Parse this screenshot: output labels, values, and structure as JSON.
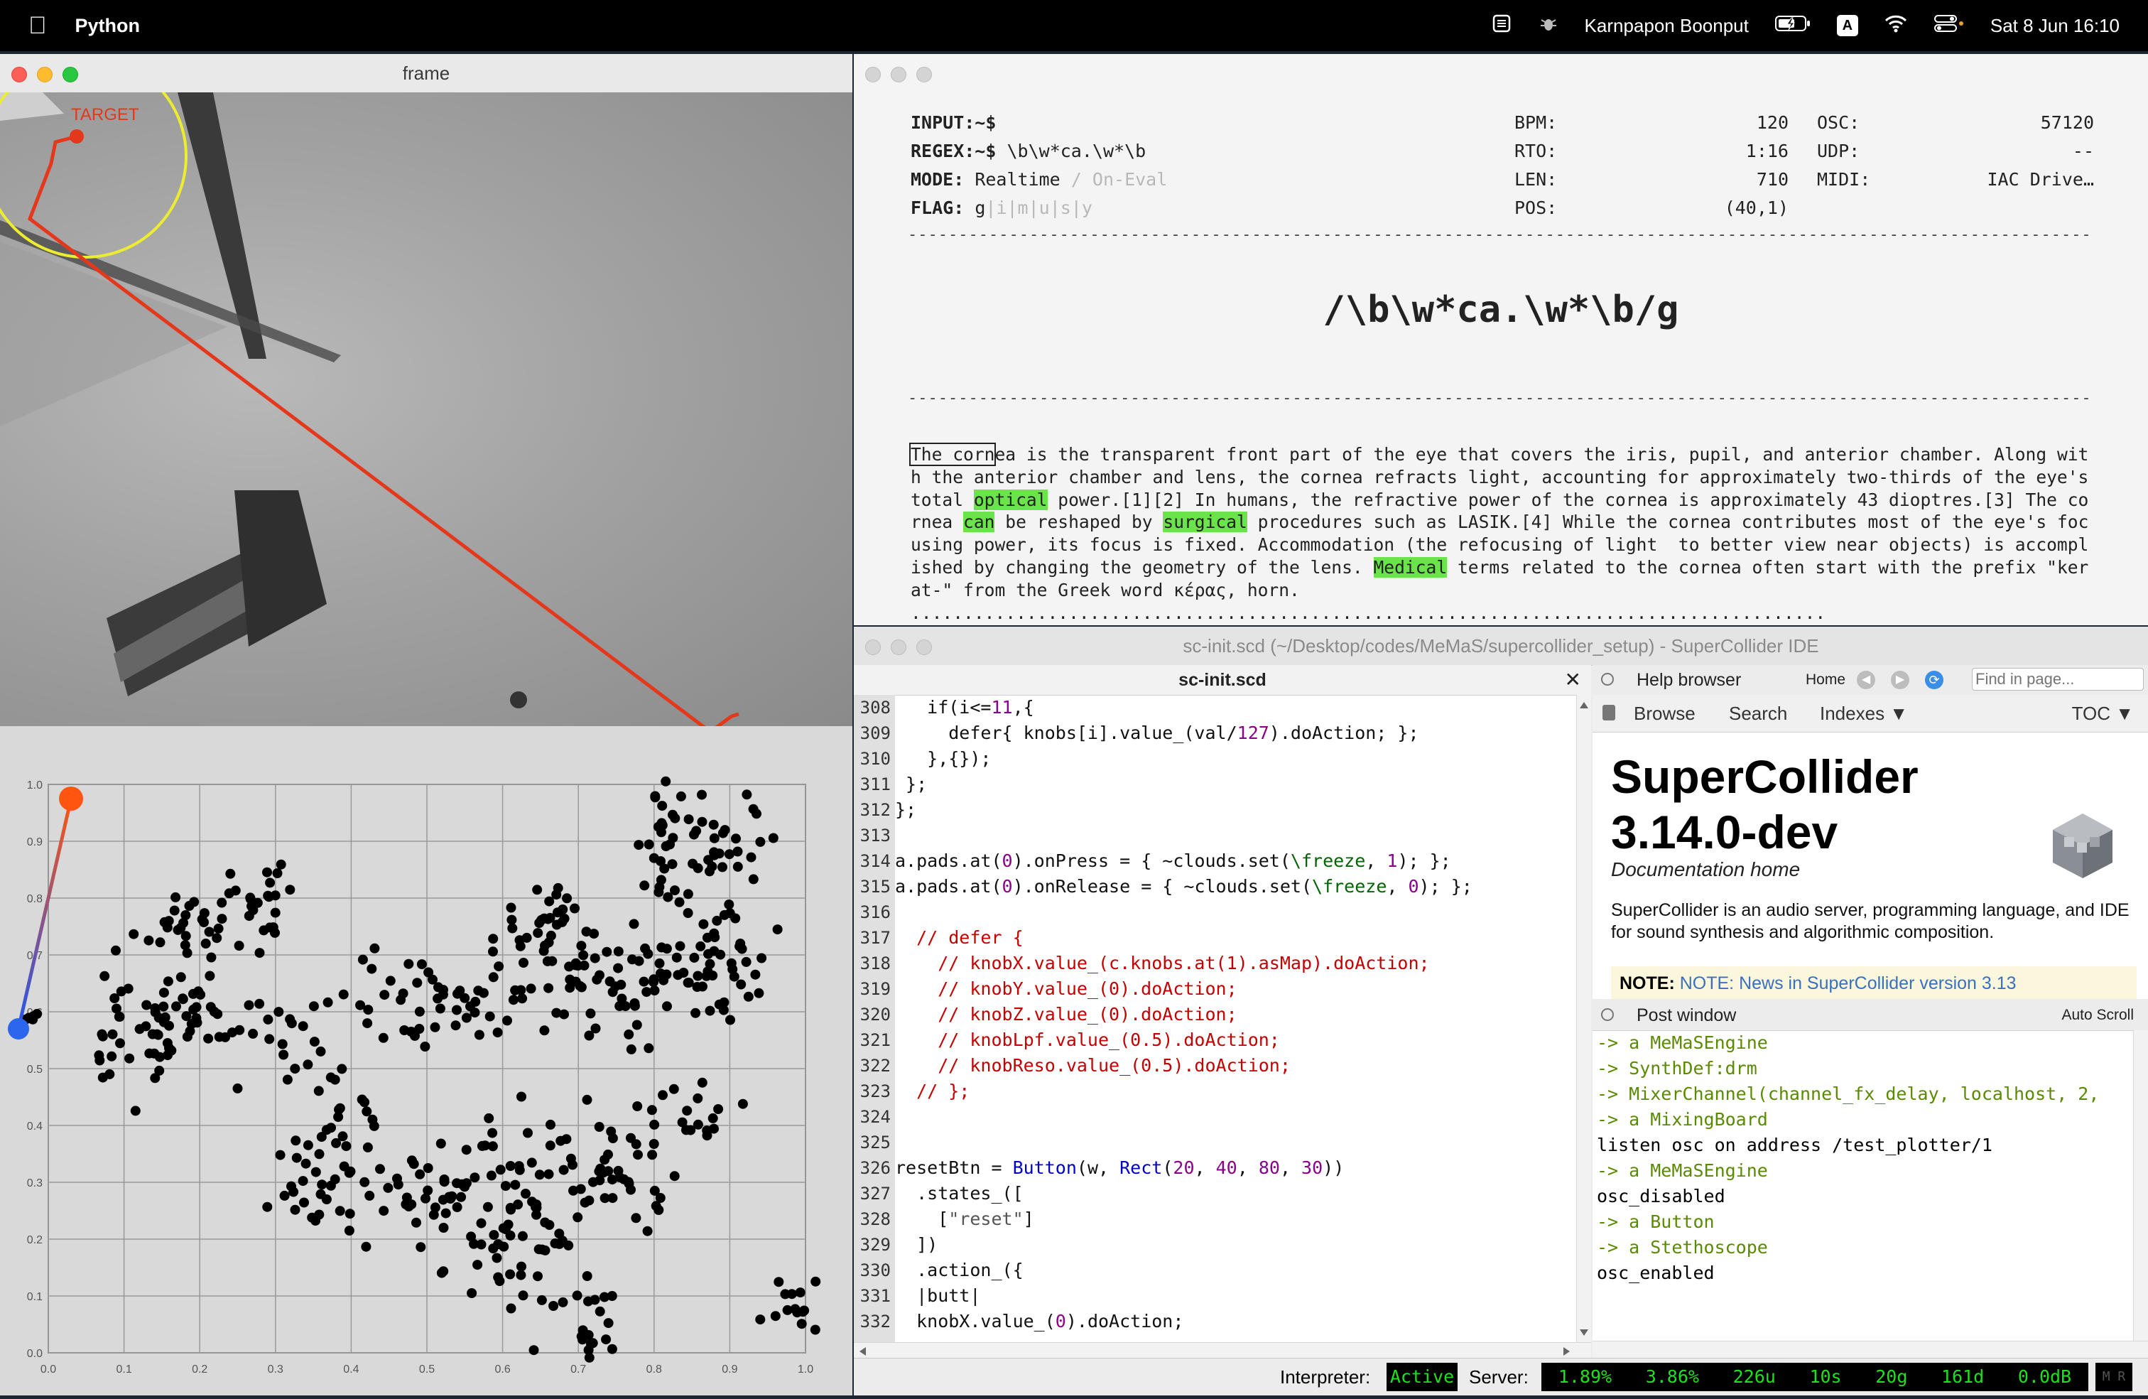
{
  "menubar": {
    "app_name": "Python",
    "user": "Karnpapon Boonput",
    "datetime": "Sat 8 Jun  16:10",
    "input_badge": "A"
  },
  "frame_window": {
    "title": "frame",
    "target_label": "TARGET"
  },
  "plotter": {
    "y_ticks": [
      "1.0",
      "0.9",
      "0.8",
      "0.7",
      "0.6",
      "0.5",
      "0.4",
      "0.3",
      "0.2",
      "0.1",
      "0.0"
    ],
    "x_ticks": [
      "0.0",
      "0.1",
      "0.2",
      "0.3",
      "0.4",
      "0.5",
      "0.6",
      "0.7",
      "0.8",
      "0.9",
      "1.0"
    ]
  },
  "regex_window": {
    "input_label": "INPUT:~$",
    "regex_label": "REGEX:~$",
    "regex_value": "\\b\\w*ca.\\w*\\b",
    "mode_label": "MODE:",
    "mode_value": "Realtime",
    "mode_alt": "/ On-Eval",
    "flag_label": "FLAG:",
    "flag_active": "g",
    "flag_rest": "|i|m|u|s|y",
    "bpm_label": "BPM:",
    "bpm_value": "120",
    "rto_label": "RTO:",
    "rto_value": "1:16",
    "len_label": "LEN:",
    "len_value": "710",
    "pos_label": "POS:",
    "pos_value": "(40,1)",
    "osc_label": "OSC:",
    "osc_value": "57120",
    "udp_label": "UDP:",
    "udp_value": "--",
    "midi_label": "MIDI:",
    "midi_value": "IAC Drive…",
    "big_regex": "/\\b\\w*ca.\\w*\\b/g",
    "text_segments": [
      {
        "t": "The corn",
        "cls": "cursor-box"
      },
      {
        "t": "ea is the transparent front part of the eye that covers the iris, pupil, and anterior chamber. Along with the anterior chamber and lens, the cornea refracts light, accounting for approximately two-thirds of the eye's total ",
        "cls": ""
      },
      {
        "t": "optical",
        "cls": "hl"
      },
      {
        "t": " power.[1][2] In humans, the refractive power of the cornea is approximately 43 dioptres.[3] The cornea ",
        "cls": ""
      },
      {
        "t": "can",
        "cls": "hl"
      },
      {
        "t": " be reshaped by ",
        "cls": ""
      },
      {
        "t": "surgical",
        "cls": "hl"
      },
      {
        "t": " procedures such as LASIK.[4] While the cornea contributes most of the eye's focusing power, its focus is fixed. Accommodation (the refocusing of light  to better view near objects) is accomplished by changing the geometry of the lens. ",
        "cls": ""
      },
      {
        "t": "Medical",
        "cls": "hl"
      },
      {
        "t": " terms related to the cornea often start with the prefix \"kerat-\" from the Greek word κέρας, horn. .......................................................................................",
        "cls": ""
      }
    ]
  },
  "supercollider": {
    "title": "sc-init.scd (~/Desktop/codes/MeMaS/supercollider_setup) - SuperCollider IDE",
    "tab_name": "sc-init.scd",
    "code_lines": [
      {
        "n": "308",
        "html": "   if(i<=<span class=\"c-num\">11</span>,{"
      },
      {
        "n": "309",
        "html": "     defer{ knobs[i].value_(val/<span class=\"c-num\">127</span>).doAction; };"
      },
      {
        "n": "310",
        "html": "   },{});"
      },
      {
        "n": "311",
        "html": " };"
      },
      {
        "n": "312",
        "html": "};"
      },
      {
        "n": "313",
        "html": ""
      },
      {
        "n": "314",
        "html": "a.pads.at(<span class=\"c-num\">0</span>).onPress = { ~clouds.set(<span class=\"c-sym\">\\freeze</span>, <span class=\"c-num\">1</span>); };"
      },
      {
        "n": "315",
        "html": "a.pads.at(<span class=\"c-num\">0</span>).onRelease = { ~clouds.set(<span class=\"c-sym\">\\freeze</span>, <span class=\"c-num\">0</span>); };"
      },
      {
        "n": "316",
        "html": ""
      },
      {
        "n": "317",
        "html": "<span class=\"c-com\">  // defer {</span>"
      },
      {
        "n": "318",
        "html": "<span class=\"c-com\">    // knobX.value_(c.knobs.at(1).asMap).doAction;</span>"
      },
      {
        "n": "319",
        "html": "<span class=\"c-com\">    // knobY.value_(0).doAction;</span>"
      },
      {
        "n": "320",
        "html": "<span class=\"c-com\">    // knobZ.value_(0).doAction;</span>"
      },
      {
        "n": "321",
        "html": "<span class=\"c-com\">    // knobLpf.value_(0.5).doAction;</span>"
      },
      {
        "n": "322",
        "html": "<span class=\"c-com\">    // knobReso.value_(0.5).doAction;</span>"
      },
      {
        "n": "323",
        "html": "<span class=\"c-com\">  // };</span>"
      },
      {
        "n": "324",
        "html": ""
      },
      {
        "n": "325",
        "html": ""
      },
      {
        "n": "326",
        "html": "resetBtn = <span class=\"c-cls\">Button</span>(w, <span class=\"c-cls\">Rect</span>(<span class=\"c-num\">20</span>, <span class=\"c-num\">40</span>, <span class=\"c-num\">80</span>, <span class=\"c-num\">30</span>))"
      },
      {
        "n": "327",
        "html": "  .states_(["
      },
      {
        "n": "328",
        "html": "    [<span class=\"c-str\">\"reset\"</span>]"
      },
      {
        "n": "329",
        "html": "  ])"
      },
      {
        "n": "330",
        "html": "  .action_({"
      },
      {
        "n": "331",
        "html": "  |butt|"
      },
      {
        "n": "332",
        "html": "  knobX.value_(<span class=\"c-num\">0</span>).doAction;"
      }
    ],
    "help_title": "Help browser",
    "help_home": "Home",
    "find_placeholder": "Find in page...",
    "nav_browse": "Browse",
    "nav_search": "Search",
    "nav_indexes": "Indexes ▼",
    "nav_toc": "TOC ▼",
    "doc_title": "SuperCollider 3.14.0-dev",
    "doc_subtitle": "Documentation home",
    "doc_body": "SuperCollider is an audio server, programming language, and IDE for sound synthesis and algorithmic composition.",
    "doc_note": "NOTE: News in SuperCollider version 3.13",
    "post_title": "Post window",
    "auto_scroll": "Auto Scroll",
    "post_lines": [
      {
        "t": "-> a MeMaSEngine",
        "c": "post-green"
      },
      {
        "t": "-> SynthDef:drm",
        "c": "post-green"
      },
      {
        "t": "-> MixerChannel(channel_fx_delay, localhost, 2,",
        "c": "post-green"
      },
      {
        "t": "-> a MixingBoard",
        "c": "post-green"
      },
      {
        "t": "listen osc on address /test_plotter/1",
        "c": ""
      },
      {
        "t": "-> a MeMaSEngine",
        "c": "post-green"
      },
      {
        "t": "osc_disabled",
        "c": ""
      },
      {
        "t": "-> a Button",
        "c": "post-green"
      },
      {
        "t": "-> a Stethoscope",
        "c": "post-green"
      },
      {
        "t": "osc_enabled",
        "c": ""
      }
    ],
    "interpreter_label": "Interpreter:",
    "interpreter_status": "Active",
    "server_label": "Server:",
    "server_stats": [
      "1.89%",
      "3.86%",
      "226u",
      "10s",
      "20g",
      "161d",
      "0.0dB"
    ]
  }
}
